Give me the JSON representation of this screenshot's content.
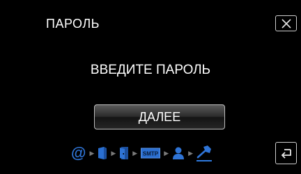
{
  "header": {
    "title": "ПАРОЛЬ",
    "close_icon": "close-x-icon"
  },
  "main": {
    "prompt": "ВВЕДИТЕ ПАРОЛЬ",
    "next_button_label": "ДАЛЕЕ"
  },
  "steps": {
    "items": [
      {
        "icon": "at-sign-icon",
        "text": "@"
      },
      {
        "icon": "server-icon"
      },
      {
        "icon": "door-icon"
      },
      {
        "icon": "smtp-icon",
        "text": "SMTP"
      },
      {
        "icon": "user-icon"
      },
      {
        "icon": "key-icon",
        "current": true
      }
    ],
    "separator_icon": "small-right-arrow-icon"
  },
  "footer": {
    "back_icon": "return-arrow-icon"
  },
  "colors": {
    "background": "#000000",
    "text": "#ffffff",
    "step_blue": "#2f74d6",
    "separator_gray": "#7a7a7a",
    "button_border": "#bdbdbd"
  }
}
